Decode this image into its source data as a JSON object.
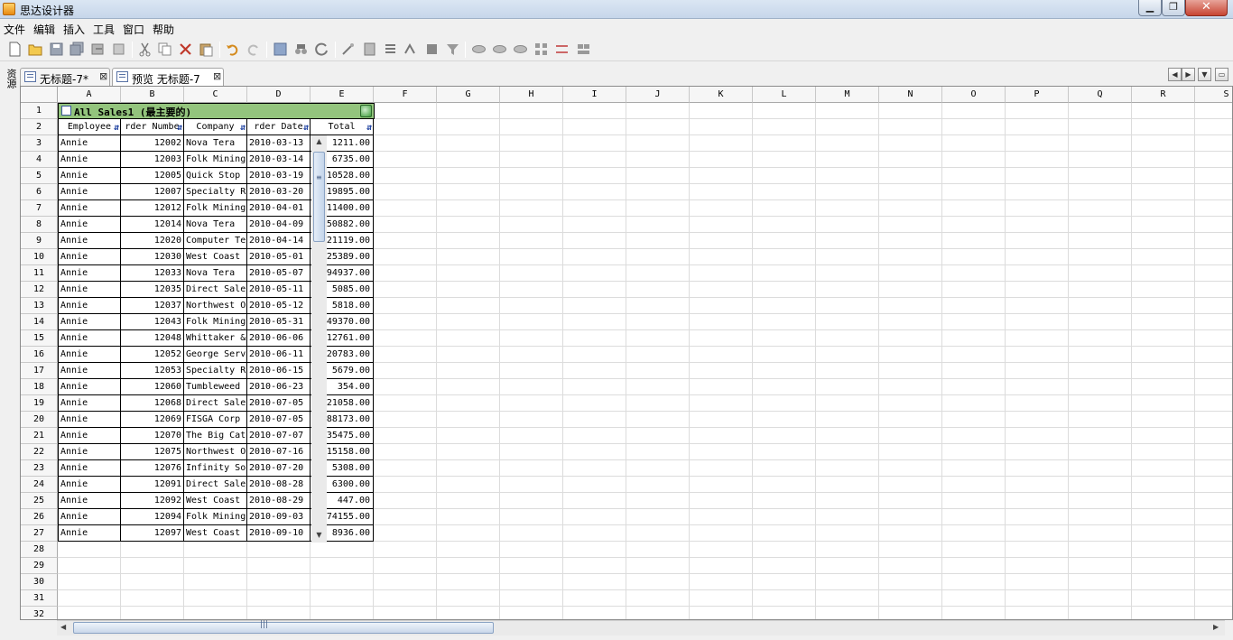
{
  "app": {
    "title": "思达设计器"
  },
  "menu": [
    "文件",
    "编辑",
    "插入",
    "工具",
    "窗口",
    "帮助"
  ],
  "side_label": "资源",
  "tabs": [
    {
      "label": "无标题-7*",
      "close": "⊠"
    },
    {
      "label": "预览 无标题-7",
      "close": "⊠"
    }
  ],
  "columns": [
    "A",
    "B",
    "C",
    "D",
    "E",
    "F",
    "G",
    "H",
    "I",
    "J",
    "K",
    "L",
    "M",
    "N",
    "O",
    "P",
    "Q",
    "R",
    "S"
  ],
  "row_numbers": [
    "1",
    "2",
    "3",
    "4",
    "5",
    "6",
    "7",
    "8",
    "9",
    "10",
    "11",
    "12",
    "13",
    "14",
    "15",
    "16",
    "17",
    "18",
    "19",
    "20",
    "21",
    "22",
    "23",
    "24",
    "25",
    "26",
    "27",
    "28",
    "29",
    "30",
    "31",
    "32"
  ],
  "table": {
    "title": "All Sales1 (最主要的)",
    "headers": [
      "Employee",
      "rder Numbe",
      "Company",
      "rder Date",
      "Total"
    ],
    "rows": [
      [
        "Annie",
        "12002",
        "Nova Tera",
        "2010-03-13",
        "1211.00"
      ],
      [
        "Annie",
        "12003",
        "Folk Mining",
        "2010-03-14",
        "6735.00"
      ],
      [
        "Annie",
        "12005",
        "Quick Stop",
        "2010-03-19",
        "10528.00"
      ],
      [
        "Annie",
        "12007",
        "Specialty R",
        "2010-03-20",
        "19895.00"
      ],
      [
        "Annie",
        "12012",
        "Folk Mining",
        "2010-04-01",
        "11400.00"
      ],
      [
        "Annie",
        "12014",
        "Nova Tera",
        "2010-04-09",
        "50882.00"
      ],
      [
        "Annie",
        "12020",
        "Computer Te",
        "2010-04-14",
        "21119.00"
      ],
      [
        "Annie",
        "12030",
        "West Coast (",
        "2010-05-01",
        "25389.00"
      ],
      [
        "Annie",
        "12033",
        "Nova Tera",
        "2010-05-07",
        "94937.00"
      ],
      [
        "Annie",
        "12035",
        "Direct Sale",
        "2010-05-11",
        "5085.00"
      ],
      [
        "Annie",
        "12037",
        "Northwest O",
        "2010-05-12",
        "5818.00"
      ],
      [
        "Annie",
        "12043",
        "Folk Mining",
        "2010-05-31",
        "49370.00"
      ],
      [
        "Annie",
        "12048",
        "Whittaker &",
        "2010-06-06",
        "12761.00"
      ],
      [
        "Annie",
        "12052",
        "George Serv",
        "2010-06-11",
        "20783.00"
      ],
      [
        "Annie",
        "12053",
        "Specialty R",
        "2010-06-15",
        "5679.00"
      ],
      [
        "Annie",
        "12060",
        "Tumbleweed (",
        "2010-06-23",
        "354.00"
      ],
      [
        "Annie",
        "12068",
        "Direct Sale",
        "2010-07-05",
        "21058.00"
      ],
      [
        "Annie",
        "12069",
        "FISGA Corp",
        "2010-07-05",
        "88173.00"
      ],
      [
        "Annie",
        "12070",
        "The Big Cat",
        "2010-07-07",
        "35475.00"
      ],
      [
        "Annie",
        "12075",
        "Northwest O",
        "2010-07-16",
        "15158.00"
      ],
      [
        "Annie",
        "12076",
        "Infinity So",
        "2010-07-20",
        "5308.00"
      ],
      [
        "Annie",
        "12091",
        "Direct Sale",
        "2010-08-28",
        "6300.00"
      ],
      [
        "Annie",
        "12092",
        "West Coast (",
        "2010-08-29",
        "447.00"
      ],
      [
        "Annie",
        "12094",
        "Folk Mining",
        "2010-09-03",
        "74155.00"
      ],
      [
        "Annie",
        "12097",
        "West Coast (",
        "2010-09-10",
        "8936.00"
      ]
    ]
  },
  "icons": {
    "window": [
      "minimize-icon",
      "maximize-icon",
      "close-icon"
    ],
    "toolbar": [
      "new-file-icon",
      "open-folder-icon",
      "save-icon",
      "save-all-icon",
      "export-icon",
      "print-preview-icon",
      "cut-icon",
      "copy-icon",
      "delete-icon",
      "paste-icon",
      "undo-icon",
      "redo-icon",
      "data-source-icon",
      "query-icon",
      "refresh-icon",
      "wizard-icon",
      "calc-icon",
      "insert-row-icon",
      "insert-column-icon",
      "chart-icon",
      "filter-icon",
      "merge-icon",
      "group-icon",
      "ungroup-icon",
      "grid-icon",
      "split-icon",
      "layout-icon"
    ]
  },
  "colors": {
    "title_band": "#93c47d",
    "sort_arrow": "#1b3f9f"
  }
}
